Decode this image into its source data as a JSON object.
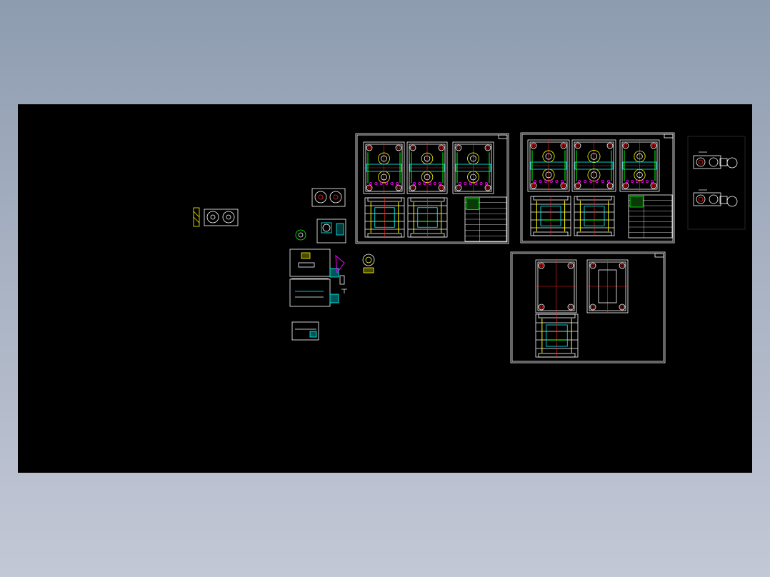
{
  "window": {
    "background_top": "#8e9cb0",
    "background_bottom": "#c3c8d6"
  },
  "viewer": {
    "canvas_background": "#000000",
    "palette": {
      "outline": "#ffffff",
      "accent_red": "#ff2020",
      "accent_yellow": "#ffff00",
      "accent_green": "#00ff00",
      "accent_cyan": "#00ffff",
      "accent_magenta": "#ff00ff",
      "accent_blue": "#3a6cff"
    },
    "sheets": [
      {
        "name": "mold-assembly-sheet-1",
        "kind": "drawing-sheet"
      },
      {
        "name": "mold-assembly-sheet-2",
        "kind": "drawing-sheet"
      },
      {
        "name": "mold-base-sheet",
        "kind": "drawing-sheet"
      },
      {
        "name": "part-details-cluster",
        "kind": "detail-views"
      },
      {
        "name": "side-parts-cluster",
        "kind": "detail-views"
      },
      {
        "name": "small-part-left",
        "kind": "detail-views"
      }
    ]
  }
}
